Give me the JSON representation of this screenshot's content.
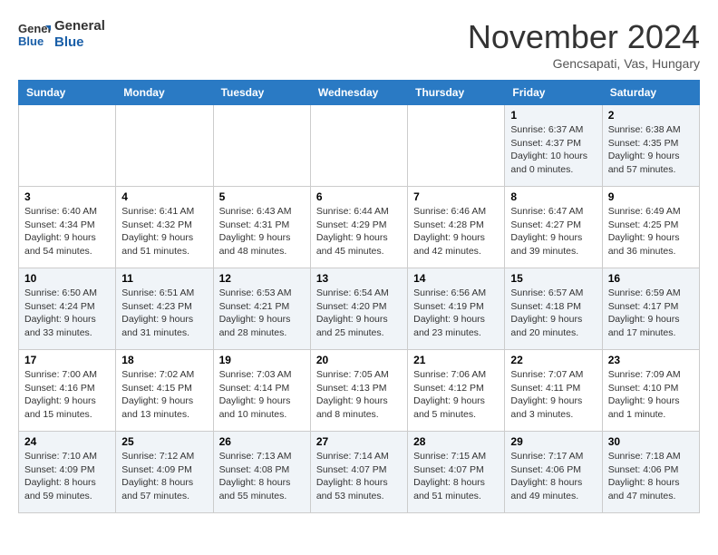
{
  "header": {
    "logo_general": "General",
    "logo_blue": "Blue",
    "month_title": "November 2024",
    "subtitle": "Gencsapati, Vas, Hungary"
  },
  "weekdays": [
    "Sunday",
    "Monday",
    "Tuesday",
    "Wednesday",
    "Thursday",
    "Friday",
    "Saturday"
  ],
  "weeks": [
    [
      {
        "day": "",
        "info": ""
      },
      {
        "day": "",
        "info": ""
      },
      {
        "day": "",
        "info": ""
      },
      {
        "day": "",
        "info": ""
      },
      {
        "day": "",
        "info": ""
      },
      {
        "day": "1",
        "info": "Sunrise: 6:37 AM\nSunset: 4:37 PM\nDaylight: 10 hours\nand 0 minutes."
      },
      {
        "day": "2",
        "info": "Sunrise: 6:38 AM\nSunset: 4:35 PM\nDaylight: 9 hours\nand 57 minutes."
      }
    ],
    [
      {
        "day": "3",
        "info": "Sunrise: 6:40 AM\nSunset: 4:34 PM\nDaylight: 9 hours\nand 54 minutes."
      },
      {
        "day": "4",
        "info": "Sunrise: 6:41 AM\nSunset: 4:32 PM\nDaylight: 9 hours\nand 51 minutes."
      },
      {
        "day": "5",
        "info": "Sunrise: 6:43 AM\nSunset: 4:31 PM\nDaylight: 9 hours\nand 48 minutes."
      },
      {
        "day": "6",
        "info": "Sunrise: 6:44 AM\nSunset: 4:29 PM\nDaylight: 9 hours\nand 45 minutes."
      },
      {
        "day": "7",
        "info": "Sunrise: 6:46 AM\nSunset: 4:28 PM\nDaylight: 9 hours\nand 42 minutes."
      },
      {
        "day": "8",
        "info": "Sunrise: 6:47 AM\nSunset: 4:27 PM\nDaylight: 9 hours\nand 39 minutes."
      },
      {
        "day": "9",
        "info": "Sunrise: 6:49 AM\nSunset: 4:25 PM\nDaylight: 9 hours\nand 36 minutes."
      }
    ],
    [
      {
        "day": "10",
        "info": "Sunrise: 6:50 AM\nSunset: 4:24 PM\nDaylight: 9 hours\nand 33 minutes."
      },
      {
        "day": "11",
        "info": "Sunrise: 6:51 AM\nSunset: 4:23 PM\nDaylight: 9 hours\nand 31 minutes."
      },
      {
        "day": "12",
        "info": "Sunrise: 6:53 AM\nSunset: 4:21 PM\nDaylight: 9 hours\nand 28 minutes."
      },
      {
        "day": "13",
        "info": "Sunrise: 6:54 AM\nSunset: 4:20 PM\nDaylight: 9 hours\nand 25 minutes."
      },
      {
        "day": "14",
        "info": "Sunrise: 6:56 AM\nSunset: 4:19 PM\nDaylight: 9 hours\nand 23 minutes."
      },
      {
        "day": "15",
        "info": "Sunrise: 6:57 AM\nSunset: 4:18 PM\nDaylight: 9 hours\nand 20 minutes."
      },
      {
        "day": "16",
        "info": "Sunrise: 6:59 AM\nSunset: 4:17 PM\nDaylight: 9 hours\nand 17 minutes."
      }
    ],
    [
      {
        "day": "17",
        "info": "Sunrise: 7:00 AM\nSunset: 4:16 PM\nDaylight: 9 hours\nand 15 minutes."
      },
      {
        "day": "18",
        "info": "Sunrise: 7:02 AM\nSunset: 4:15 PM\nDaylight: 9 hours\nand 13 minutes."
      },
      {
        "day": "19",
        "info": "Sunrise: 7:03 AM\nSunset: 4:14 PM\nDaylight: 9 hours\nand 10 minutes."
      },
      {
        "day": "20",
        "info": "Sunrise: 7:05 AM\nSunset: 4:13 PM\nDaylight: 9 hours\nand 8 minutes."
      },
      {
        "day": "21",
        "info": "Sunrise: 7:06 AM\nSunset: 4:12 PM\nDaylight: 9 hours\nand 5 minutes."
      },
      {
        "day": "22",
        "info": "Sunrise: 7:07 AM\nSunset: 4:11 PM\nDaylight: 9 hours\nand 3 minutes."
      },
      {
        "day": "23",
        "info": "Sunrise: 7:09 AM\nSunset: 4:10 PM\nDaylight: 9 hours\nand 1 minute."
      }
    ],
    [
      {
        "day": "24",
        "info": "Sunrise: 7:10 AM\nSunset: 4:09 PM\nDaylight: 8 hours\nand 59 minutes."
      },
      {
        "day": "25",
        "info": "Sunrise: 7:12 AM\nSunset: 4:09 PM\nDaylight: 8 hours\nand 57 minutes."
      },
      {
        "day": "26",
        "info": "Sunrise: 7:13 AM\nSunset: 4:08 PM\nDaylight: 8 hours\nand 55 minutes."
      },
      {
        "day": "27",
        "info": "Sunrise: 7:14 AM\nSunset: 4:07 PM\nDaylight: 8 hours\nand 53 minutes."
      },
      {
        "day": "28",
        "info": "Sunrise: 7:15 AM\nSunset: 4:07 PM\nDaylight: 8 hours\nand 51 minutes."
      },
      {
        "day": "29",
        "info": "Sunrise: 7:17 AM\nSunset: 4:06 PM\nDaylight: 8 hours\nand 49 minutes."
      },
      {
        "day": "30",
        "info": "Sunrise: 7:18 AM\nSunset: 4:06 PM\nDaylight: 8 hours\nand 47 minutes."
      }
    ]
  ]
}
